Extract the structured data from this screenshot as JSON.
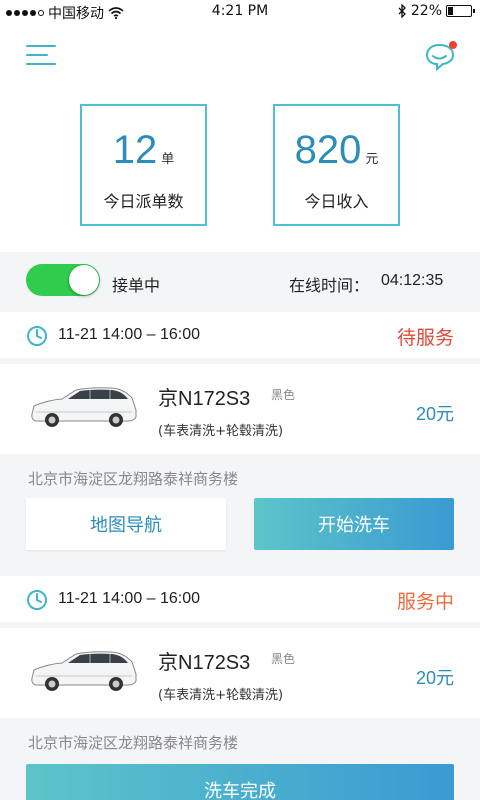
{
  "status_bar": {
    "carrier": "中国移动",
    "time": "4:21 PM",
    "battery": "22%",
    "battery_level": 0.22
  },
  "header": {
    "menu_icon": "hamburger-menu-icon",
    "chat_icon": "chat-bubble-icon",
    "has_unread": true
  },
  "stats": [
    {
      "value": "12",
      "unit": "单",
      "label": "今日派单数"
    },
    {
      "value": "820",
      "unit": "元",
      "label": "今日收入"
    }
  ],
  "online": {
    "toggle_on": true,
    "status_label": "接单中",
    "time_label": "在线时间：",
    "time_value": "04:12:35"
  },
  "orders": [
    {
      "time": "11-21 14:00 – 16:00",
      "status": "待服务",
      "plate": "京N172S3",
      "color": "黑色",
      "service": "(车表清洗+轮毂清洗)",
      "price": "20元",
      "address": "北京市海淀区龙翔路泰祥商务楼",
      "nav_button": "地图导航",
      "start_button": "开始洗车"
    },
    {
      "time": "11-21 14:00 – 16:00",
      "status": "服务中",
      "plate": "京N172S3",
      "color": "黑色",
      "service": "(车表清洗+轮毂清洗)",
      "price": "20元",
      "address": "北京市海淀区龙翔路泰祥商务楼",
      "done_button": "洗车完成"
    }
  ],
  "colors": {
    "accent": "#3cb6c8",
    "price": "#2b8db8",
    "status_pending": "#e04a3a",
    "status_serving": "#ee6b3c",
    "toggle": "#2fcc4d"
  }
}
